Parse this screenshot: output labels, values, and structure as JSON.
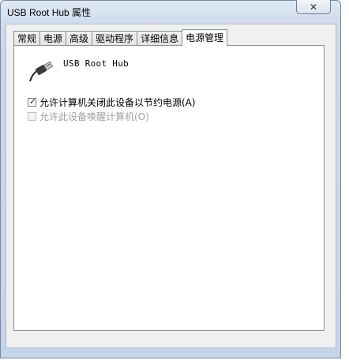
{
  "window": {
    "title": "USB Root Hub 属性",
    "close_label": "✕"
  },
  "tabs": [
    {
      "label": "常规",
      "active": false
    },
    {
      "label": "电源",
      "active": false
    },
    {
      "label": "高级",
      "active": false
    },
    {
      "label": "驱动程序",
      "active": false
    },
    {
      "label": "详细信息",
      "active": false
    },
    {
      "label": "电源管理",
      "active": true
    }
  ],
  "panel": {
    "device_name": "USB Root Hub",
    "device_icon": "usb-plug-icon",
    "options": [
      {
        "label": "允许计算机关闭此设备以节约电源(A)",
        "checked": true,
        "enabled": true
      },
      {
        "label": "允许此设备唤醒计算机(O)",
        "checked": false,
        "enabled": false
      }
    ]
  },
  "colors": {
    "title_bg": "#c9d8ea",
    "panel_bg": "#ffffff",
    "disabled_text": "#a0a0a0"
  }
}
